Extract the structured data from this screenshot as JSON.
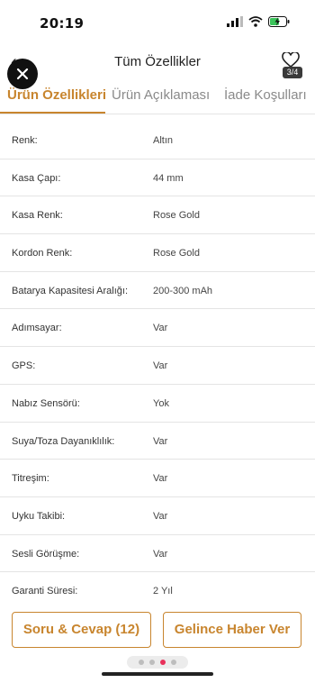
{
  "status_bar": {
    "time": "20:19"
  },
  "header": {
    "title": "Tüm Özellikler",
    "image_counter": "3/4"
  },
  "tabs": [
    {
      "label": "Ürün Özellikleri",
      "active": true
    },
    {
      "label": "Ürün Açıklaması",
      "active": false
    },
    {
      "label": "İade Koşulları",
      "active": false
    }
  ],
  "specs": [
    {
      "key": "Renk:",
      "value": "Altın"
    },
    {
      "key": "Kasa Çapı:",
      "value": "44 mm"
    },
    {
      "key": "Kasa Renk:",
      "value": "Rose Gold"
    },
    {
      "key": "Kordon Renk:",
      "value": "Rose Gold"
    },
    {
      "key": "Batarya Kapasitesi Aralığı:",
      "value": "200-300 mAh"
    },
    {
      "key": "Adımsayar:",
      "value": "Var"
    },
    {
      "key": "GPS:",
      "value": "Var"
    },
    {
      "key": "Nabız Sensörü:",
      "value": "Yok"
    },
    {
      "key": "Suya/Toza Dayanıklılık:",
      "value": "Var"
    },
    {
      "key": "Titreşim:",
      "value": "Var"
    },
    {
      "key": "Uyku Takibi:",
      "value": "Var"
    },
    {
      "key": "Sesli Görüşme:",
      "value": "Var"
    },
    {
      "key": "Garanti Süresi:",
      "value": "2 Yıl"
    }
  ],
  "bottom": {
    "qa_button": "Soru & Cevap (12)",
    "notify_button": "Gelince Haber Ver"
  },
  "colors": {
    "accent": "#c8852e",
    "active_dot": "#e8305a"
  }
}
